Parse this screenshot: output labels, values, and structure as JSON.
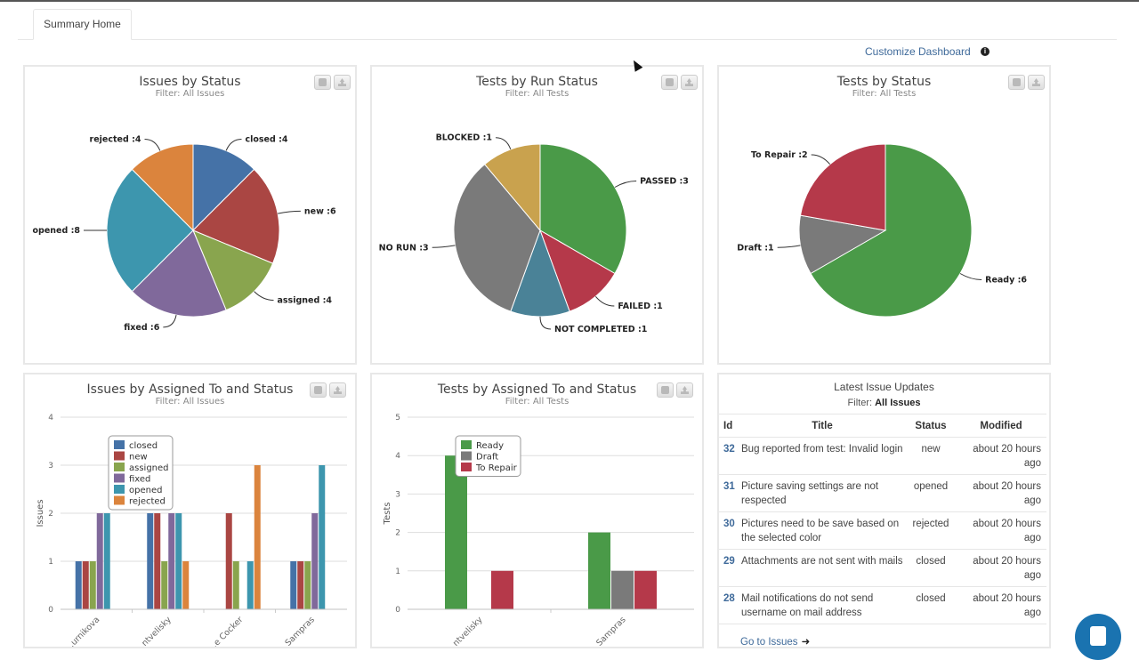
{
  "tabs": [
    {
      "label": "Summary Home",
      "active": true
    }
  ],
  "header": {
    "customize_label": "Customize Dashboard",
    "info_icon": "info-icon"
  },
  "panels": {
    "issues_by_status": {
      "title": "Issues by Status",
      "filter": "Filter: All Issues"
    },
    "tests_by_run_status": {
      "title": "Tests by Run Status",
      "filter": "Filter: All Tests"
    },
    "tests_by_status": {
      "title": "Tests by Status",
      "filter": "Filter: All Tests"
    },
    "issues_by_assigned": {
      "title": "Issues by Assigned To and Status",
      "filter": "Filter: All Issues"
    },
    "tests_by_assigned": {
      "title": "Tests by Assigned To and Status",
      "filter": "Filter: All Tests"
    }
  },
  "chart_data": [
    {
      "id": "issues_by_status",
      "type": "pie",
      "title": "Issues by Status",
      "subtitle": "Filter: All Issues",
      "slices": [
        {
          "label": "closed",
          "value": 4,
          "color": "#4572a7"
        },
        {
          "label": "new",
          "value": 6,
          "color": "#aa4643"
        },
        {
          "label": "assigned",
          "value": 4,
          "color": "#89a54e"
        },
        {
          "label": "fixed",
          "value": 6,
          "color": "#80699b"
        },
        {
          "label": "opened",
          "value": 8,
          "color": "#3d96ae"
        },
        {
          "label": "rejected",
          "value": 4,
          "color": "#db843d"
        }
      ]
    },
    {
      "id": "tests_by_run_status",
      "type": "pie",
      "title": "Tests by Run Status",
      "subtitle": "Filter: All Tests",
      "slices": [
        {
          "label": "PASSED",
          "value": 3,
          "color": "#4a9a48"
        },
        {
          "label": "FAILED",
          "value": 1,
          "color": "#b5394a"
        },
        {
          "label": "NOT COMPLETED",
          "value": 1,
          "color": "#4a8297"
        },
        {
          "label": "NO RUN",
          "value": 3,
          "color": "#7a7a7a"
        },
        {
          "label": "BLOCKED",
          "value": 1,
          "color": "#c9a24e"
        }
      ]
    },
    {
      "id": "tests_by_status",
      "type": "pie",
      "title": "Tests by Status",
      "subtitle": "Filter: All Tests",
      "slices": [
        {
          "label": "Ready",
          "value": 6,
          "color": "#4a9a48"
        },
        {
          "label": "Draft",
          "value": 1,
          "color": "#7a7a7a"
        },
        {
          "label": "To Repair",
          "value": 2,
          "color": "#b5394a"
        }
      ]
    },
    {
      "id": "issues_by_assigned",
      "type": "bar",
      "title": "Issues by Assigned To and Status",
      "subtitle": "Filter: All Issues",
      "ylabel": "Issues",
      "xlabel": "",
      "ylim": [
        0,
        4
      ],
      "yticks": [
        0,
        1,
        2,
        3,
        4
      ],
      "grid": true,
      "legend": "top-left",
      "categories": [
        "…urnikova",
        "…ntvelisky",
        "…e Cocker",
        "Sampras"
      ],
      "series": [
        {
          "name": "closed",
          "color": "#4572a7",
          "values": [
            1,
            2,
            0,
            1
          ]
        },
        {
          "name": "new",
          "color": "#aa4643",
          "values": [
            1,
            2,
            2,
            1
          ]
        },
        {
          "name": "assigned",
          "color": "#89a54e",
          "values": [
            1,
            1,
            1,
            1
          ]
        },
        {
          "name": "fixed",
          "color": "#80699b",
          "values": [
            2,
            2,
            0,
            2
          ]
        },
        {
          "name": "opened",
          "color": "#3d96ae",
          "values": [
            2,
            2,
            1,
            3
          ]
        },
        {
          "name": "rejected",
          "color": "#db843d",
          "values": [
            0,
            1,
            3,
            0
          ]
        }
      ]
    },
    {
      "id": "tests_by_assigned",
      "type": "bar",
      "title": "Tests by Assigned To and Status",
      "subtitle": "Filter: All Tests",
      "ylabel": "Tests",
      "xlabel": "",
      "ylim": [
        0,
        5
      ],
      "yticks": [
        0,
        1,
        2,
        3,
        4,
        5
      ],
      "grid": true,
      "legend": "top-left",
      "categories": [
        "…ntvelisky",
        "Sampras"
      ],
      "series": [
        {
          "name": "Ready",
          "color": "#4a9a48",
          "values": [
            4,
            2
          ]
        },
        {
          "name": "Draft",
          "color": "#7a7a7a",
          "values": [
            0,
            1
          ]
        },
        {
          "name": "To Repair",
          "color": "#b5394a",
          "values": [
            1,
            1
          ]
        }
      ]
    }
  ],
  "latest_updates": {
    "title": "Latest Issue Updates",
    "filter_prefix": "Filter:",
    "filter_value": "All Issues",
    "columns": [
      "Id",
      "Title",
      "Status",
      "Modified"
    ],
    "rows": [
      {
        "id": "32",
        "title": "Bug reported from test: Invalid login",
        "status": "new",
        "modified": "about 20 hours ago"
      },
      {
        "id": "31",
        "title": "Picture saving settings are not respected",
        "status": "opened",
        "modified": "about 20 hours ago"
      },
      {
        "id": "30",
        "title": "Pictures need to be save based on the selected color",
        "status": "rejected",
        "modified": "about 20 hours ago"
      },
      {
        "id": "29",
        "title": "Attachments are not sent with mails",
        "status": "closed",
        "modified": "about 20 hours ago"
      },
      {
        "id": "28",
        "title": "Mail notifications do not send username on mail address",
        "status": "closed",
        "modified": "about 20 hours ago"
      }
    ],
    "goto_label": "Go to Issues",
    "goto_arrow": "➜"
  }
}
